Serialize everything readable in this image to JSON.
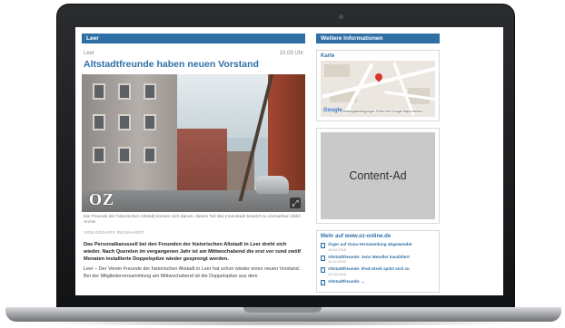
{
  "article": {
    "section": "Leer",
    "location": "Leer",
    "time": "10.09 Uhr",
    "headline": "Altstadtfreunde haben neuen Vorstand",
    "photo_logo": "OZ",
    "caption": "Die Freunde der historischen Altstadt können sich darum: dieses Teil des Innenstadt besetzt zu vermarkten (Bild: Archiv",
    "byline": "VON EDGARS REINHARDT",
    "lead": "Das Personalkarussell bei den Freunden der historischen Altstadt in Leer dreht sich wieder. Nach Querelen im vergangenen Jahr ist am Mittwochabend die erst vor rund zwölf Monaten installierte Doppelspitze wieder gesprengt worden.",
    "body": "Leer – Der Verein Freunde der historischen Altstadt in Leer hat schon wieder einen neuen Vorstand. Bei der Mitgliederversammlung am Mittwochabend ist die Doppelspitze aus dem"
  },
  "sidebar": {
    "header": "Weitere Informationen",
    "map": {
      "title": "Karte",
      "logo": "Google",
      "terms": "Nutzungsbedingungen   Fehler bei Google Maps melden"
    },
    "ad": {
      "label": "Content-Ad"
    },
    "more": {
      "title": "Mehr auf www.oz-online.de",
      "items": [
        {
          "title": "Ärger auf Oxea-Versammlung abgewendet",
          "date": "10.04.2015"
        },
        {
          "title": "Altstadtfreunde: Jens Wendler kandidiert",
          "date": "11.04.2015"
        },
        {
          "title": "Altstadtfreunde: iPad-Streit spitzt sich zu",
          "date": "14.04.2015"
        },
        {
          "title": "Altstadtfreunde: ...",
          "date": ""
        }
      ]
    }
  },
  "colors": {
    "accent": "#2f6fa5",
    "ad_background": "#c9c9c9",
    "bezel": "#1b1c1f"
  }
}
